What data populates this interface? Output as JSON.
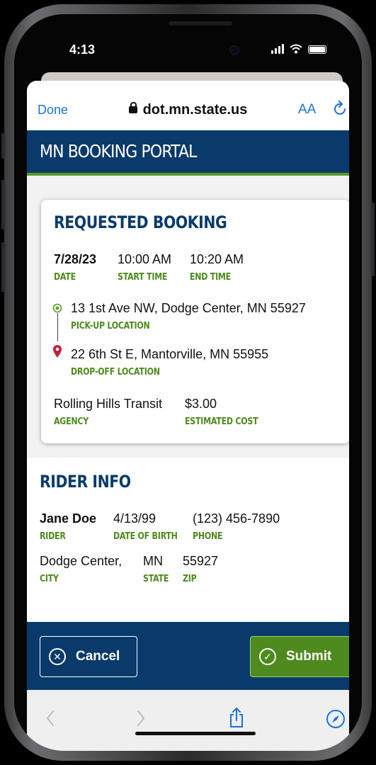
{
  "status": {
    "time": "4:13"
  },
  "browser": {
    "done_label": "Done",
    "url": "dot.mn.state.us",
    "text_size_label": "AA",
    "reload_icon": "reload-icon",
    "lock_icon": "lock-icon"
  },
  "portal": {
    "title": "MN BOOKING PORTAL"
  },
  "booking": {
    "title": "REQUESTED BOOKING",
    "date": {
      "value": "7/28/23",
      "label": "DATE"
    },
    "start_time": {
      "value": "10:00 AM",
      "label": "START TIME"
    },
    "end_time": {
      "value": "10:20 AM",
      "label": "END TIME"
    },
    "pickup": {
      "value": "13 1st Ave NW, Dodge Center, MN 55927",
      "label": "PICK-UP LOCATION"
    },
    "dropoff": {
      "value": "22 6th St E, Mantorville, MN 55955",
      "label": "DROP-OFF LOCATION"
    },
    "agency": {
      "value": "Rolling Hills Transit",
      "label": "AGENCY"
    },
    "cost": {
      "value": "$3.00",
      "label": "ESTIMATED COST"
    }
  },
  "rider": {
    "title": "RIDER INFO",
    "name": {
      "value": "Jane Doe",
      "label": "RIDER"
    },
    "dob": {
      "value": "4/13/99",
      "label": "DATE OF BIRTH"
    },
    "phone": {
      "value": "(123) 456-7890",
      "label": "PHONE"
    },
    "city": {
      "value": "Dodge Center,",
      "label": "CITY"
    },
    "state": {
      "value": "MN",
      "label": "STATE"
    },
    "zip": {
      "value": "55927",
      "label": "ZIP"
    }
  },
  "actions": {
    "cancel_label": "Cancel",
    "submit_label": "Submit"
  },
  "colors": {
    "navy": "#0a3a6b",
    "green": "#5b9a2b",
    "label_green": "#4f8a1e",
    "pin_red": "#c0223b",
    "link_blue": "#1a73d8"
  }
}
